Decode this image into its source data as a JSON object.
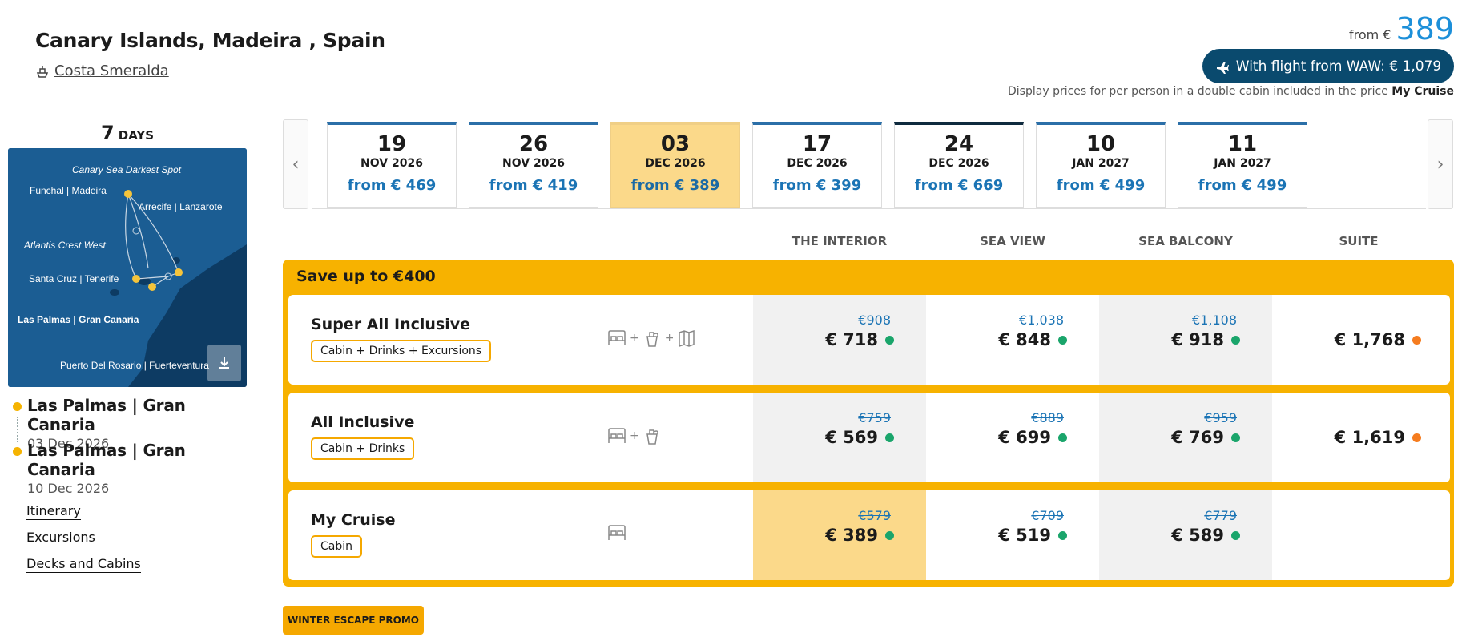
{
  "header": {
    "title": "Canary Islands, Madeira , Spain",
    "ship": "Costa Smeralda",
    "price_from_label": "from €",
    "price_from_value": "389",
    "flight_button": "With flight from WAW: € 1,079",
    "disclaimer": "Display prices for per person in a double cabin included in the price",
    "disclaimer_bold": "My Cruise"
  },
  "left": {
    "days_number": "7",
    "days_unit": "DAYS",
    "map_labels": {
      "canary_sea": "Canary Sea Darkest Spot",
      "funchal": "Funchal | Madeira",
      "arrecife": "Arrecife | Lanzarote",
      "atlantis": "Atlantis Crest West",
      "santa_cruz": "Santa Cruz | Tenerife",
      "las_palmas": "Las Palmas | Gran Canaria",
      "puerto": "Puerto Del Rosario | Fuerteventura"
    },
    "route": [
      {
        "port": "Las Palmas | Gran Canaria",
        "date": "03 Dec 2026"
      },
      {
        "port": "Las Palmas | Gran Canaria",
        "date": "10 Dec 2026"
      }
    ],
    "links": [
      "Itinerary",
      "Excursions",
      "Decks and Cabins"
    ]
  },
  "dates": [
    {
      "day": "19",
      "month": "NOV 2026",
      "price": "from € 469"
    },
    {
      "day": "26",
      "month": "NOV 2026",
      "price": "from € 419"
    },
    {
      "day": "03",
      "month": "DEC 2026",
      "price": "from € 389"
    },
    {
      "day": "17",
      "month": "DEC 2026",
      "price": "from € 399"
    },
    {
      "day": "24",
      "month": "DEC 2026",
      "price": "from € 669"
    },
    {
      "day": "10",
      "month": "JAN 2027",
      "price": "from € 499"
    },
    {
      "day": "11",
      "month": "JAN 2027",
      "price": "from € 499"
    }
  ],
  "columns": [
    "THE INTERIOR",
    "SEA VIEW",
    "SEA BALCONY",
    "SUITE"
  ],
  "offer": {
    "title": "Save up to €400",
    "rows": [
      {
        "name": "Super All Inclusive",
        "badge": "Cabin + Drinks + Excursions",
        "icons": [
          "bed-icon",
          "drink-icon",
          "map-icon"
        ],
        "prices": [
          {
            "old": "€908",
            "new": "€ 718",
            "status": "green"
          },
          {
            "old": "€1,038",
            "new": "€ 848",
            "status": "green"
          },
          {
            "old": "€1,108",
            "new": "€ 918",
            "status": "green"
          },
          {
            "old": "",
            "new": "€ 1,768",
            "status": "orange"
          }
        ]
      },
      {
        "name": "All Inclusive",
        "badge": "Cabin + Drinks",
        "icons": [
          "bed-icon",
          "drink-icon"
        ],
        "prices": [
          {
            "old": "€759",
            "new": "€ 569",
            "status": "green"
          },
          {
            "old": "€889",
            "new": "€ 699",
            "status": "green"
          },
          {
            "old": "€959",
            "new": "€ 769",
            "status": "green"
          },
          {
            "old": "",
            "new": "€ 1,619",
            "status": "orange"
          }
        ]
      },
      {
        "name": "My Cruise",
        "badge": "Cabin",
        "icons": [
          "bed-icon"
        ],
        "prices": [
          {
            "old": "€579",
            "new": "€ 389",
            "status": "green"
          },
          {
            "old": "€709",
            "new": "€ 519",
            "status": "green"
          },
          {
            "old": "€779",
            "new": "€ 589",
            "status": "green"
          },
          {
            "old": "",
            "new": "",
            "status": ""
          }
        ]
      }
    ]
  },
  "promo": "WINTER ESCAPE PROMO",
  "colors": {
    "accent_blue": "#1c8fd9",
    "dark_navy": "#0a4a6e",
    "offer_yellow": "#f7b200",
    "selected": "#fbd98a",
    "status_green": "#1aa56b",
    "status_orange": "#f57c1f"
  }
}
